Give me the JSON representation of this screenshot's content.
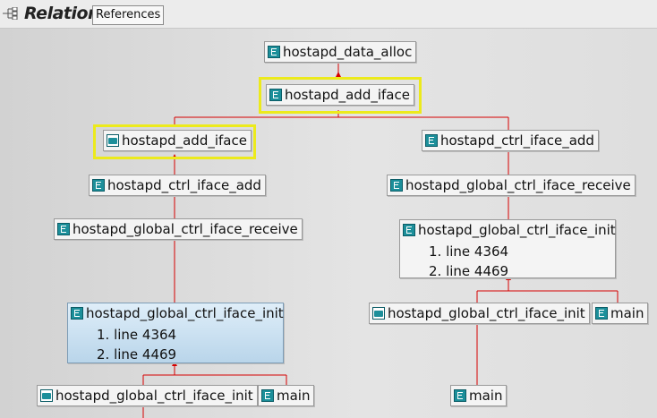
{
  "header": {
    "title": "Relation",
    "tab_label": "References",
    "icon": "relation-tree-icon"
  },
  "colors": {
    "connector": "#d60000",
    "highlight": "#ecea1c"
  },
  "nodes": {
    "n1": {
      "label": "hostapd_data_alloc",
      "icon": "function-icon"
    },
    "n2": {
      "label": "hostapd_add_iface",
      "icon": "function-icon",
      "highlighted": true
    },
    "n3": {
      "label": "hostapd_add_iface",
      "icon": "recursive-function-icon",
      "highlighted": true
    },
    "n4": {
      "label": "hostapd_ctrl_iface_add",
      "icon": "function-icon"
    },
    "n5": {
      "label": "hostapd_ctrl_iface_add",
      "icon": "function-icon"
    },
    "n6": {
      "label": "hostapd_global_ctrl_iface_receive",
      "icon": "function-icon"
    },
    "n7": {
      "label": "hostapd_global_ctrl_iface_receive",
      "icon": "function-icon"
    },
    "n8": {
      "label": "hostapd_global_ctrl_iface_init",
      "icon": "function-icon",
      "lines": [
        "1. line 4364",
        "2. line 4469"
      ]
    },
    "n9": {
      "label": "hostapd_global_ctrl_iface_init",
      "icon": "function-icon",
      "selected": true,
      "lines": [
        "1. line 4364",
        "2. line 4469"
      ]
    },
    "n10": {
      "label": "hostapd_global_ctrl_iface_init",
      "icon": "recursive-function-icon"
    },
    "n11": {
      "label": "main",
      "icon": "function-icon"
    },
    "n12": {
      "label": "hostapd_global_ctrl_iface_init",
      "icon": "recursive-function-icon"
    },
    "n13": {
      "label": "main",
      "icon": "function-icon"
    },
    "n14": {
      "label": "main",
      "icon": "function-icon"
    }
  }
}
